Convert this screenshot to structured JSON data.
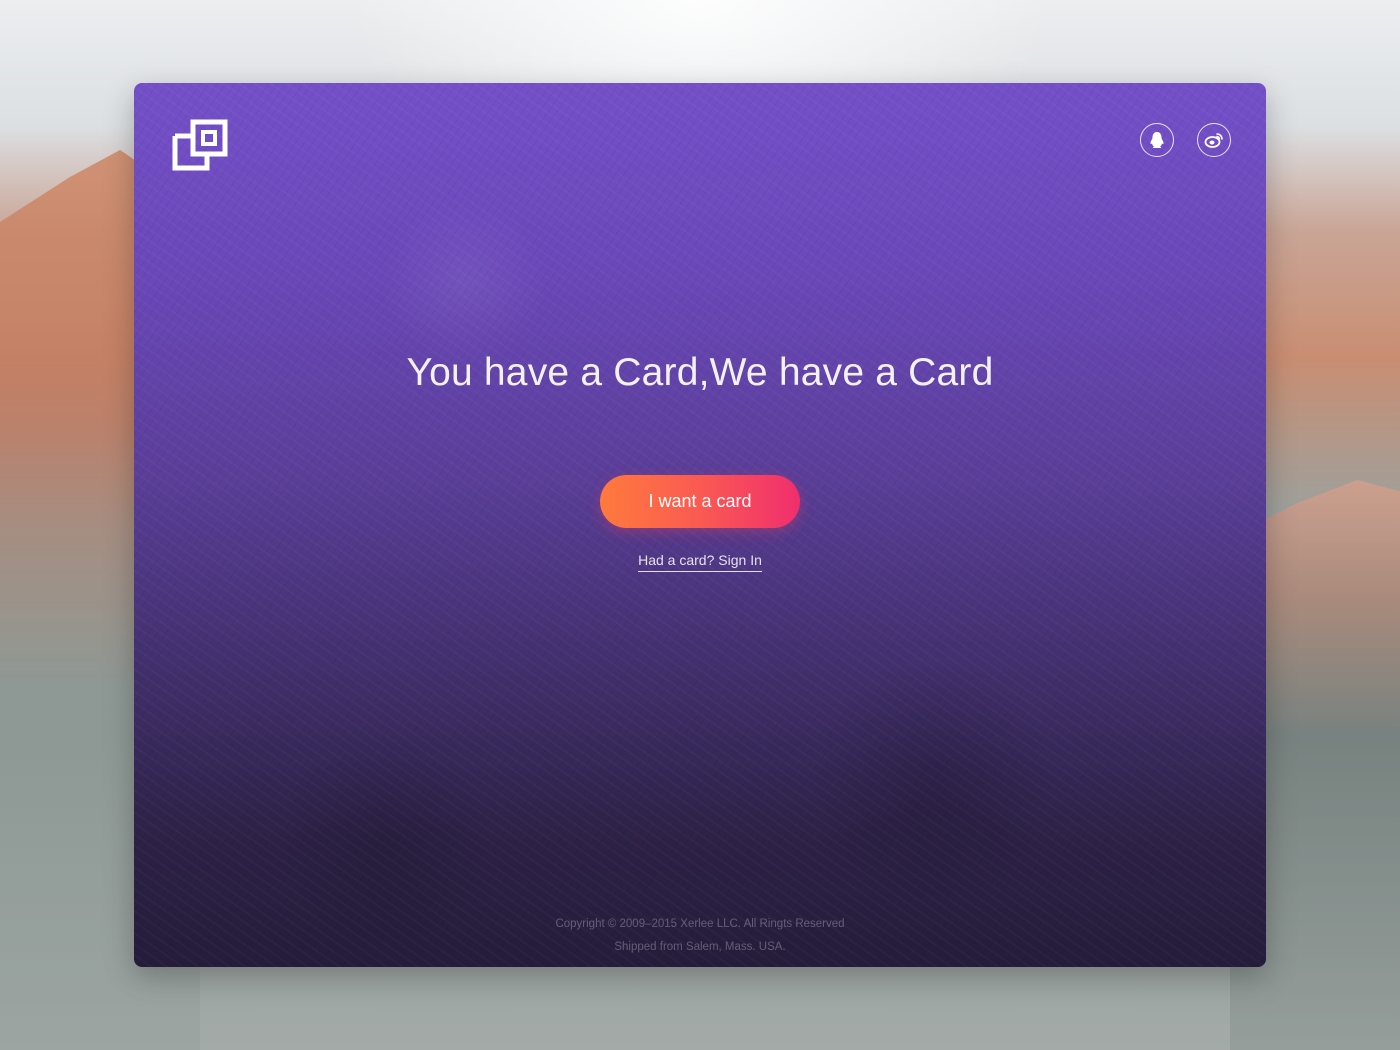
{
  "brand": {
    "logo_icon": "overlapping-squares-logo-icon"
  },
  "social": {
    "qq_icon": "qq-penguin-icon",
    "weibo_icon": "weibo-icon"
  },
  "hero": {
    "headline": "You have a Card,We have a Card",
    "cta_label": "I want a card",
    "signin_prompt": "Had a card?",
    "signin_link": "Sign In"
  },
  "footer": {
    "copyright": "Copyright © 2009–2015 Xerlee LLC. All Ringts Reserved",
    "location": "Shipped from Salem, Mass. USA."
  },
  "colors": {
    "card_top": "#7450c8",
    "card_bottom": "#251c3a",
    "cta_start": "#ff7a3d",
    "cta_end": "#f02e6e"
  }
}
